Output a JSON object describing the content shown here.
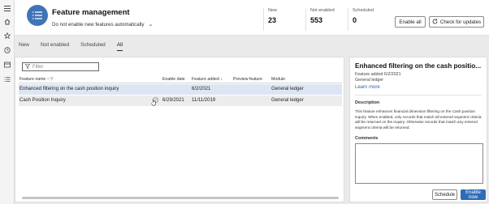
{
  "nav": {
    "icons": [
      "hamburger-icon",
      "home-icon",
      "star-icon",
      "clock-icon",
      "workspace-icon",
      "list-icon"
    ]
  },
  "header": {
    "title": "Feature management",
    "auto_enable_select": "Do not enable new features automatically",
    "tiles": [
      {
        "label": "New",
        "value": "23"
      },
      {
        "label": "Not enabled",
        "value": "553"
      },
      {
        "label": "Scheduled",
        "value": "0"
      }
    ],
    "enable_all_label": "Enable all",
    "check_updates_label": "Check for updates"
  },
  "tabs": [
    {
      "label": "New",
      "active": false
    },
    {
      "label": "Not enabled",
      "active": false
    },
    {
      "label": "Scheduled",
      "active": false
    },
    {
      "label": "All",
      "active": true
    }
  ],
  "grid": {
    "filter_placeholder": "Filter",
    "columns": [
      "Feature name",
      "Enable date",
      "Feature added",
      "Preview feature",
      "Module"
    ],
    "rows": [
      {
        "name": "Enhanced filtering on the cash position inquiry",
        "enable_date": "",
        "added": "6/2/2021",
        "preview": "",
        "module": "General ledger",
        "selected": true
      },
      {
        "name": "Cash Position Inquiry",
        "enable_date": "6/29/2021",
        "added": "11/11/2019",
        "preview": "",
        "module": "General ledger",
        "selected": false
      }
    ]
  },
  "detail": {
    "title": "Enhanced filtering on the cash positio...",
    "added": "Feature added 6/2/2021",
    "module": "General ledger",
    "learn_more": "Learn more",
    "description_label": "Description",
    "description": "This feature enhances financial dimension filtering on the Cash position inquiry. When enabled, only records that match all entered segment criteria will be returned on the inquiry. Otherwise records that match any entered segment criteria will be returned.",
    "comments_label": "Comments",
    "schedule_label": "Schedule",
    "enable_now_label": "Enable now"
  },
  "colors": {
    "accent": "#2f6cb8",
    "selected_row": "#dce6f3",
    "workspace_icon": "#3f74b7"
  }
}
